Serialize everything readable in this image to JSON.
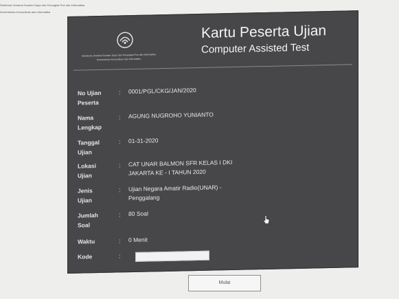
{
  "top_note": {
    "line1": "Direktorat Jenderal Sumber Daya dan Perangkat Pos dan Informatika",
    "line2": "Kementerian Komunikasi dan Informatika"
  },
  "header": {
    "logo_line1": "Direktorat Jenderal Sumber Daya dan Perangkat Pos dan Informatika",
    "logo_line2": "Kementerian Komunikasi dan Informatika",
    "title": "Kartu Peserta Ujian",
    "subtitle": "Computer Assisted Test"
  },
  "fields": [
    {
      "label": "No Ujian Peserta",
      "value": "0001/PGL/CKG/JAN/2020"
    },
    {
      "label": "Nama Lengkap",
      "value": "AGUNG NUGROHO YUNIANTO"
    },
    {
      "label": "Tanggal Ujian",
      "value": "01-31-2020"
    },
    {
      "label": "Lokasi Ujian",
      "value": "CAT UNAR BALMON SFR KELAS I DKI JAKARTA KE - I TAHUN 2020"
    },
    {
      "label": "Jenis Ujian",
      "value": "Ujian Negara Amatir Radio(UNAR) - Penggalang"
    },
    {
      "label": "Jumlah Soal",
      "value": "80 Soal"
    },
    {
      "label": "Waktu",
      "value": "0 Menit"
    }
  ],
  "kode": {
    "label": "Kode",
    "value": "",
    "placeholder": ""
  },
  "colon": ":",
  "next_button": {
    "label": "Mulai"
  },
  "colors": {
    "card": "#47474a",
    "text": "#f4f4f4",
    "page": "#eeeeec"
  }
}
